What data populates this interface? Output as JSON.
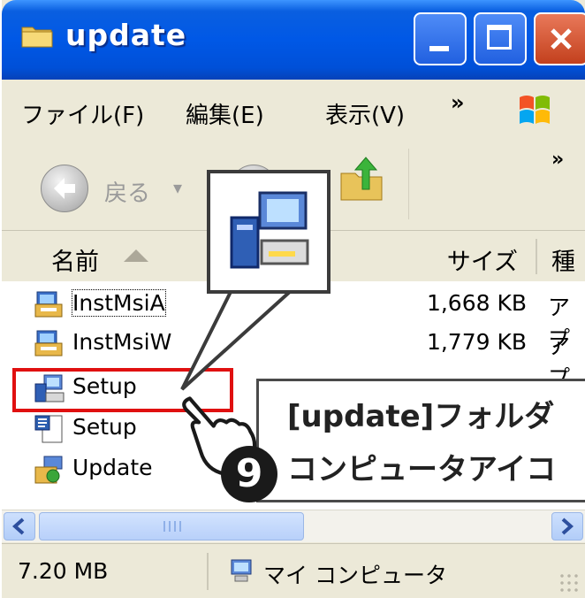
{
  "window": {
    "title": "update",
    "controls": {
      "minimize": "minimize",
      "maximize": "maximize",
      "close": "close"
    }
  },
  "menubar": {
    "items": [
      {
        "label": "ファイル(F)"
      },
      {
        "label": "編集(E)"
      },
      {
        "label": "表示(V)"
      }
    ],
    "overflow": "»"
  },
  "toolbar": {
    "back_label": "戻る",
    "back_dropdown": "▾",
    "overflow": "»"
  },
  "columns": {
    "name": "名前",
    "size": "サイズ",
    "type": "種"
  },
  "files": [
    {
      "name": "InstMsiA",
      "size": "1,668 KB",
      "type": "アプ",
      "icon": "installer-icon"
    },
    {
      "name": "InstMsiW",
      "size": "1,779 KB",
      "type": "アプ",
      "icon": "installer-icon"
    },
    {
      "name": "Setup",
      "size": "",
      "type": "",
      "icon": "setup-computer-icon"
    },
    {
      "name": "Setup",
      "size": "",
      "type": "",
      "icon": "settings-file-icon"
    },
    {
      "name": "Update",
      "size": "",
      "type": "",
      "icon": "update-installer-icon"
    }
  ],
  "statusbar": {
    "size": "7.20 MB",
    "location": "マイ コンピュータ"
  },
  "annotation": {
    "line1": "[update]フォルダ",
    "line2": "コンピュータアイコ",
    "step": "9"
  },
  "colors": {
    "titlebar": "#0058e6",
    "highlight": "#e01010",
    "window_bg": "#ece9d8"
  }
}
